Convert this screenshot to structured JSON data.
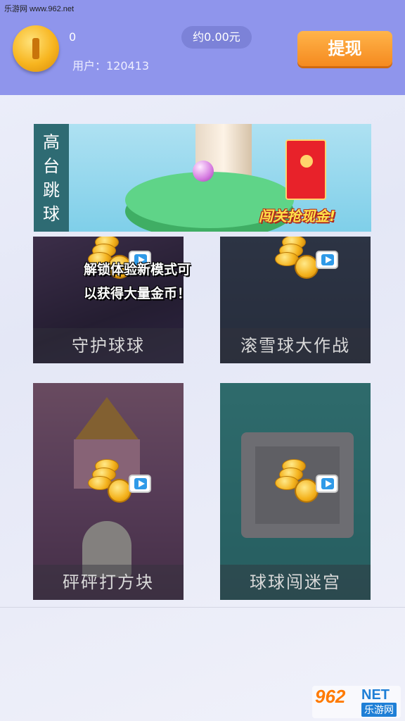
{
  "watermark_top": "乐游网 www.962.net",
  "header": {
    "coin_count": "0",
    "user_id": "用户：120413",
    "money": "约0.00元",
    "withdraw_label": "提现"
  },
  "banner": {
    "side_title": [
      "高",
      "台",
      "跳",
      "球"
    ],
    "slogan": "闯关抢现金!"
  },
  "unlock_message": [
    "解锁体验新模式可",
    "以获得大量金币！"
  ],
  "games": [
    {
      "label": "守护球球"
    },
    {
      "label": "滚雪球大作战"
    },
    {
      "label": "砰砰打方块"
    },
    {
      "label": "球球闯迷宫"
    }
  ],
  "watermark_bottom": {
    "num": "962",
    "net": "NET",
    "cn": "乐游网"
  },
  "colors": {
    "header_bg": "#8f95ec",
    "withdraw_button": "#f58a1f",
    "banner_side": "#2e6b73"
  }
}
